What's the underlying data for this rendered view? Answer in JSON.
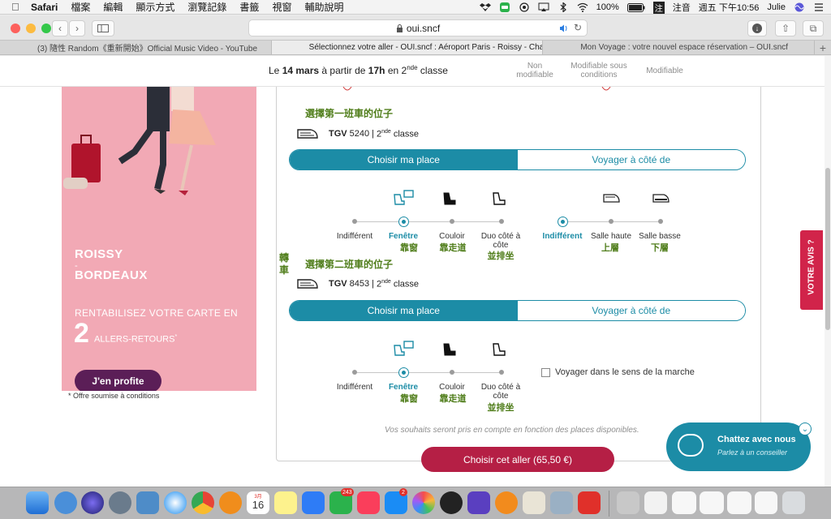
{
  "menubar": {
    "app_name": "Safari",
    "items": [
      "檔案",
      "編輯",
      "顯示方式",
      "瀏覽記錄",
      "書籤",
      "視窗",
      "輔助說明"
    ],
    "battery": "100%",
    "input_method": "注音",
    "clock": "週五 下午10:56",
    "user": "Julie"
  },
  "browser": {
    "url": "oui.sncf",
    "tabs": [
      "(3) 隨性 Random《重新開始》Official Music Video - YouTube",
      "Sélectionnez votre aller - OUI.sncf : Aéroport Paris - Roissy - Charles-d...",
      "Mon Voyage : votre nouvel espace réservation – OUI.sncf"
    ],
    "active_tab": 1
  },
  "sticky": {
    "prefix": "Le",
    "date": "14 mars",
    "mid": "à partir de",
    "time": "17h",
    "class_mid": "en",
    "class_num": "2",
    "class_sup": "nde",
    "class_word": "classe",
    "fare_labels": [
      "Non modifiable",
      "Modifiable sous conditions",
      "Modifiable"
    ]
  },
  "promo": {
    "city1": "ROISSY",
    "dash": "-",
    "city2": "BORDEAUX",
    "line1": "RENTABILISEZ VOTRE CARTE EN",
    "big_number": "2",
    "line2": "ALLERS-RETOURS",
    "line2_sup": "*",
    "cta": "J'en profite",
    "footnote": "* Offre soumise à conditions"
  },
  "annotations": {
    "first": "選擇第一班車的位子",
    "transfer": "轉車",
    "second": "選擇第二班車的位子"
  },
  "segments": [
    {
      "train_type": "TGV",
      "train_number": "5240",
      "class_num": "2",
      "class_sup": "nde",
      "class_word": "classe",
      "tab_active": "Choisir ma place",
      "tab_inactive": "Voyager à côté de",
      "seat_options": [
        {
          "label": "Indifférent",
          "zh": ""
        },
        {
          "label": "Fenêtre",
          "zh": "靠窗"
        },
        {
          "label": "Couloir",
          "zh": "靠走道"
        },
        {
          "label": "Duo côté à côte",
          "zh": "並排坐"
        }
      ],
      "seat_selected": 1,
      "deck_options": [
        {
          "label": "Indifférent",
          "zh": ""
        },
        {
          "label": "Salle haute",
          "zh": "上層"
        },
        {
          "label": "Salle basse",
          "zh": "下層"
        }
      ],
      "deck_selected": 0
    },
    {
      "train_type": "TGV",
      "train_number": "8453",
      "class_num": "2",
      "class_sup": "nde",
      "class_word": "classe",
      "tab_active": "Choisir ma place",
      "tab_inactive": "Voyager à côté de",
      "seat_options": [
        {
          "label": "Indifférent",
          "zh": ""
        },
        {
          "label": "Fenêtre",
          "zh": "靠窗"
        },
        {
          "label": "Couloir",
          "zh": "靠走道"
        },
        {
          "label": "Duo côté à côte",
          "zh": "並排坐"
        }
      ],
      "seat_selected": 1,
      "direction_checkbox": "Voyager dans le sens de la marche"
    }
  ],
  "footer": {
    "wishes": "Vos souhaits seront pris en compte en fonction des places disponibles.",
    "choose_button": "Choisir cet aller (65,50 €)"
  },
  "chat": {
    "title": "Chattez avec nous",
    "subtitle": "Parlez à un conseiller"
  },
  "feedback": "VOTRE AVIS ?",
  "dock": {
    "calendar_month": "3月",
    "calendar_day": "16",
    "line_badge": "243",
    "appstore_badge": "2"
  },
  "colors": {
    "teal": "#1c8ca6",
    "crimson": "#b51f45",
    "promo_pink": "#f2a9b5",
    "promo_button": "#5b1e57",
    "annotation_green": "#4f7d1a"
  }
}
